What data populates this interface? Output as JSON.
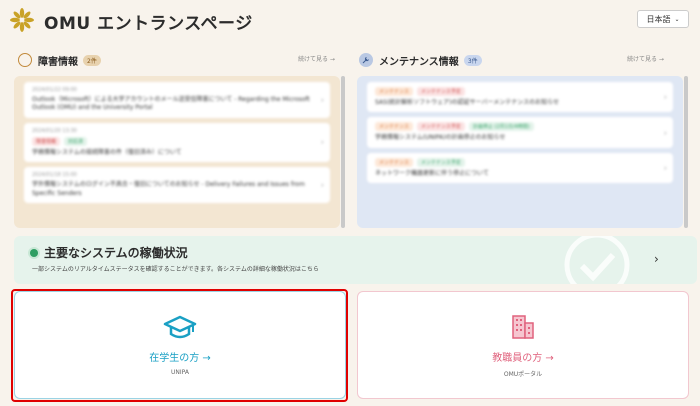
{
  "header": {
    "title": "OMU エントランスページ",
    "language": "日本語",
    "logo_icon": "omu-flower-logo"
  },
  "incident": {
    "title": "障害情報",
    "count": "2件",
    "more": "続けて見る →",
    "items": [
      {
        "meta": "2024/01/22 09:00",
        "tags": [],
        "text": "Outlook（Microsoft）による大学アカウントのメール送受信障害について - Regarding the Microsoft Outlook (OMU) and the University Portal"
      },
      {
        "meta": "2024/01/20 13:30",
        "tags": [
          "障害情報",
          "対応済"
        ],
        "text": "学務情報システムの接続障害の件（復旧済み）について"
      },
      {
        "meta": "2024/01/18 15:00",
        "tags": [],
        "text": "学外情報システムのログイン不具合・復旧についてのお知らせ - Delivery Failures and Issues from Specific Senders"
      }
    ]
  },
  "maintenance": {
    "title": "メンテナンス情報",
    "count": "3件",
    "more": "続けて見る →",
    "items": [
      {
        "meta": "",
        "tags": [
          "メンテナンス",
          "メンテナンス予定"
        ],
        "text": "SAS(統計解析ソフトウェア)の認証サーバーメンテナンスのお知らせ"
      },
      {
        "meta": "",
        "tags": [
          "メンテナンス",
          "メンテナンス予定",
          "計画停止 (2月1日/4時間)"
        ],
        "text": "学務情報システム(UNIPA)の計画停止のお知らせ"
      },
      {
        "meta": "",
        "tags": [
          "メンテナンス",
          "メンテナンス予定"
        ],
        "text": "ネットワーク機器更新に伴う停止について"
      }
    ]
  },
  "status": {
    "title": "主要なシステムの稼働状況",
    "description": "一部システムのリアルタイムステータスを確認することができます。各システムの詳細な稼働状況はこちら"
  },
  "tiles": {
    "student": {
      "label": "在学生の方 →",
      "sub": "UNIPA"
    },
    "staff": {
      "label": "教職員の方 →",
      "sub": "OMUポータル"
    }
  },
  "colors": {
    "background": "#f8f3ec",
    "incident_panel": "#f3e6d2",
    "maintenance_panel": "#dfe7f4",
    "status_panel": "#e6f3ec",
    "student_accent": "#1aa0c4",
    "staff_accent": "#e0627d",
    "highlight": "#e00000"
  }
}
